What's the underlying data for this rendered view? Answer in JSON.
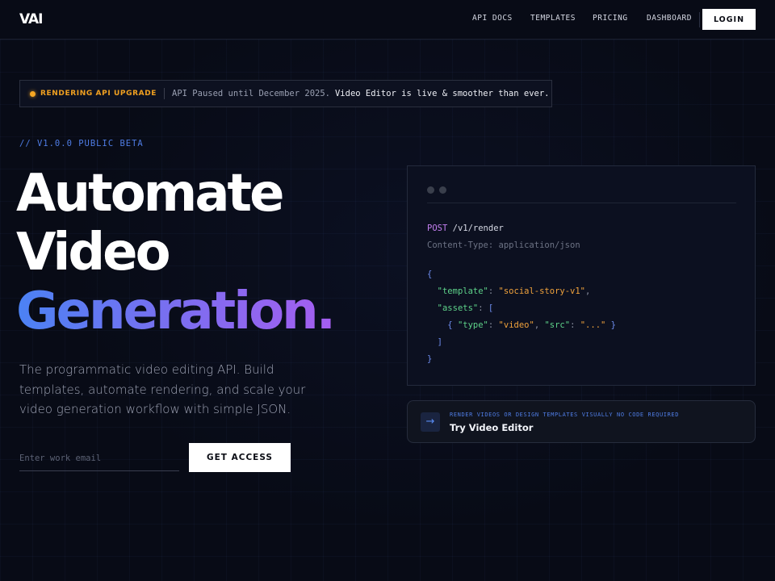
{
  "nav": {
    "logo": "VAI",
    "links": [
      "API DOCS",
      "TEMPLATES",
      "PRICING",
      "DASHBOARD"
    ],
    "login": "LOGIN"
  },
  "banner": {
    "tag": "RENDERING API UPGRADE",
    "message": "API Paused until December 2025.",
    "link": "Video Editor is live & smoother than ever."
  },
  "hero": {
    "beta": "// V1.0.0 PUBLIC BETA",
    "title_line1": "Automate",
    "title_line2": "Video",
    "title_line3": "Generation.",
    "subtitle": "The programmatic video editing API. Build templates, automate rendering, and scale your video generation workflow with simple JSON.",
    "email_placeholder": "Enter work email",
    "cta": "GET ACCESS"
  },
  "code": {
    "method": "POST",
    "path": "/v1/render",
    "header": "Content-Type: application/json",
    "open_brace": "{",
    "close_brace": "}",
    "template_key": "\"template\"",
    "template_value": "\"social-story-v1\"",
    "assets_key": "\"assets\"",
    "open_bracket": "[",
    "close_bracket": "]",
    "type_key": "\"type\"",
    "type_value": "\"video\"",
    "src_key": "\"src\"",
    "src_value": "\"...\""
  },
  "editor_card": {
    "kicker": "RENDER VIDEOS OR DESIGN TEMPLATES VISUALLY NO CODE REQUIRED",
    "title": "Try Video Editor",
    "icon": "arrow-right-icon"
  },
  "colors": {
    "background": "#080b16",
    "accent_blue": "#4f7de6",
    "accent_purple": "#a55ef0",
    "warning": "#f5a623"
  }
}
